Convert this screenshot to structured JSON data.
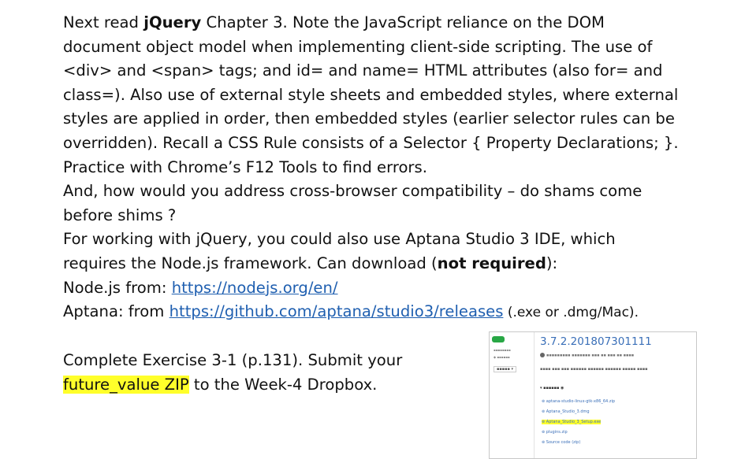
{
  "paragraph_lines": [
    [
      "Next read ",
      {
        "b": "jQuery"
      },
      " Chapter 3.  Note the JavaScript reliance on the DOM"
    ],
    [
      "document object model when implementing client-side scripting.  The use of"
    ],
    [
      "<div> and <span> tags;  and  id=  and  name=  HTML attributes (also  for=  and"
    ],
    [
      "class=).  Also use of external style sheets and embedded styles, where external"
    ],
    [
      "styles are applied in order, then embedded styles (earlier selector rules can be"
    ],
    [
      "overridden).  Recall a CSS Rule consists of a Selector { Property Declarations; }."
    ],
    [
      "Practice with Chrome’s F12 Tools to find errors."
    ],
    [
      "And, how would you address cross-browser compatibility – do shams come"
    ],
    [
      "before shims ?"
    ],
    [
      "For working with jQuery, you could also use Aptana Studio 3 IDE, which"
    ],
    [
      "requires the Node.js framework.  Can download (",
      {
        "b": "not required"
      },
      "):"
    ]
  ],
  "nodejs": {
    "label": "Node.js from:  ",
    "url": "https://nodejs.org/en/"
  },
  "aptana": {
    "label": "Aptana: from  ",
    "url": "https://github.com/aptana/studio3/releases",
    "suffix": " (.exe or .dmg/Mac)."
  },
  "exercise": {
    "line1": "Complete Exercise 3-1 (p.131).  Submit your",
    "highlight": "future_value ZIP",
    "line2_rest": " to the Week-4 Dropbox."
  },
  "thumbnail": {
    "version": "3.7.2.201807301111",
    "assets_items": [
      "aptana-studio-linux-gtk-x86_64.zip",
      "Aptana_Studio_3.dmg",
      "Aptana_Studio_3_Setup.exe",
      "plugins.zip",
      "Source code (zip)"
    ],
    "highlight_color": "#ffff2a",
    "link_color": "#3a6fb8"
  }
}
